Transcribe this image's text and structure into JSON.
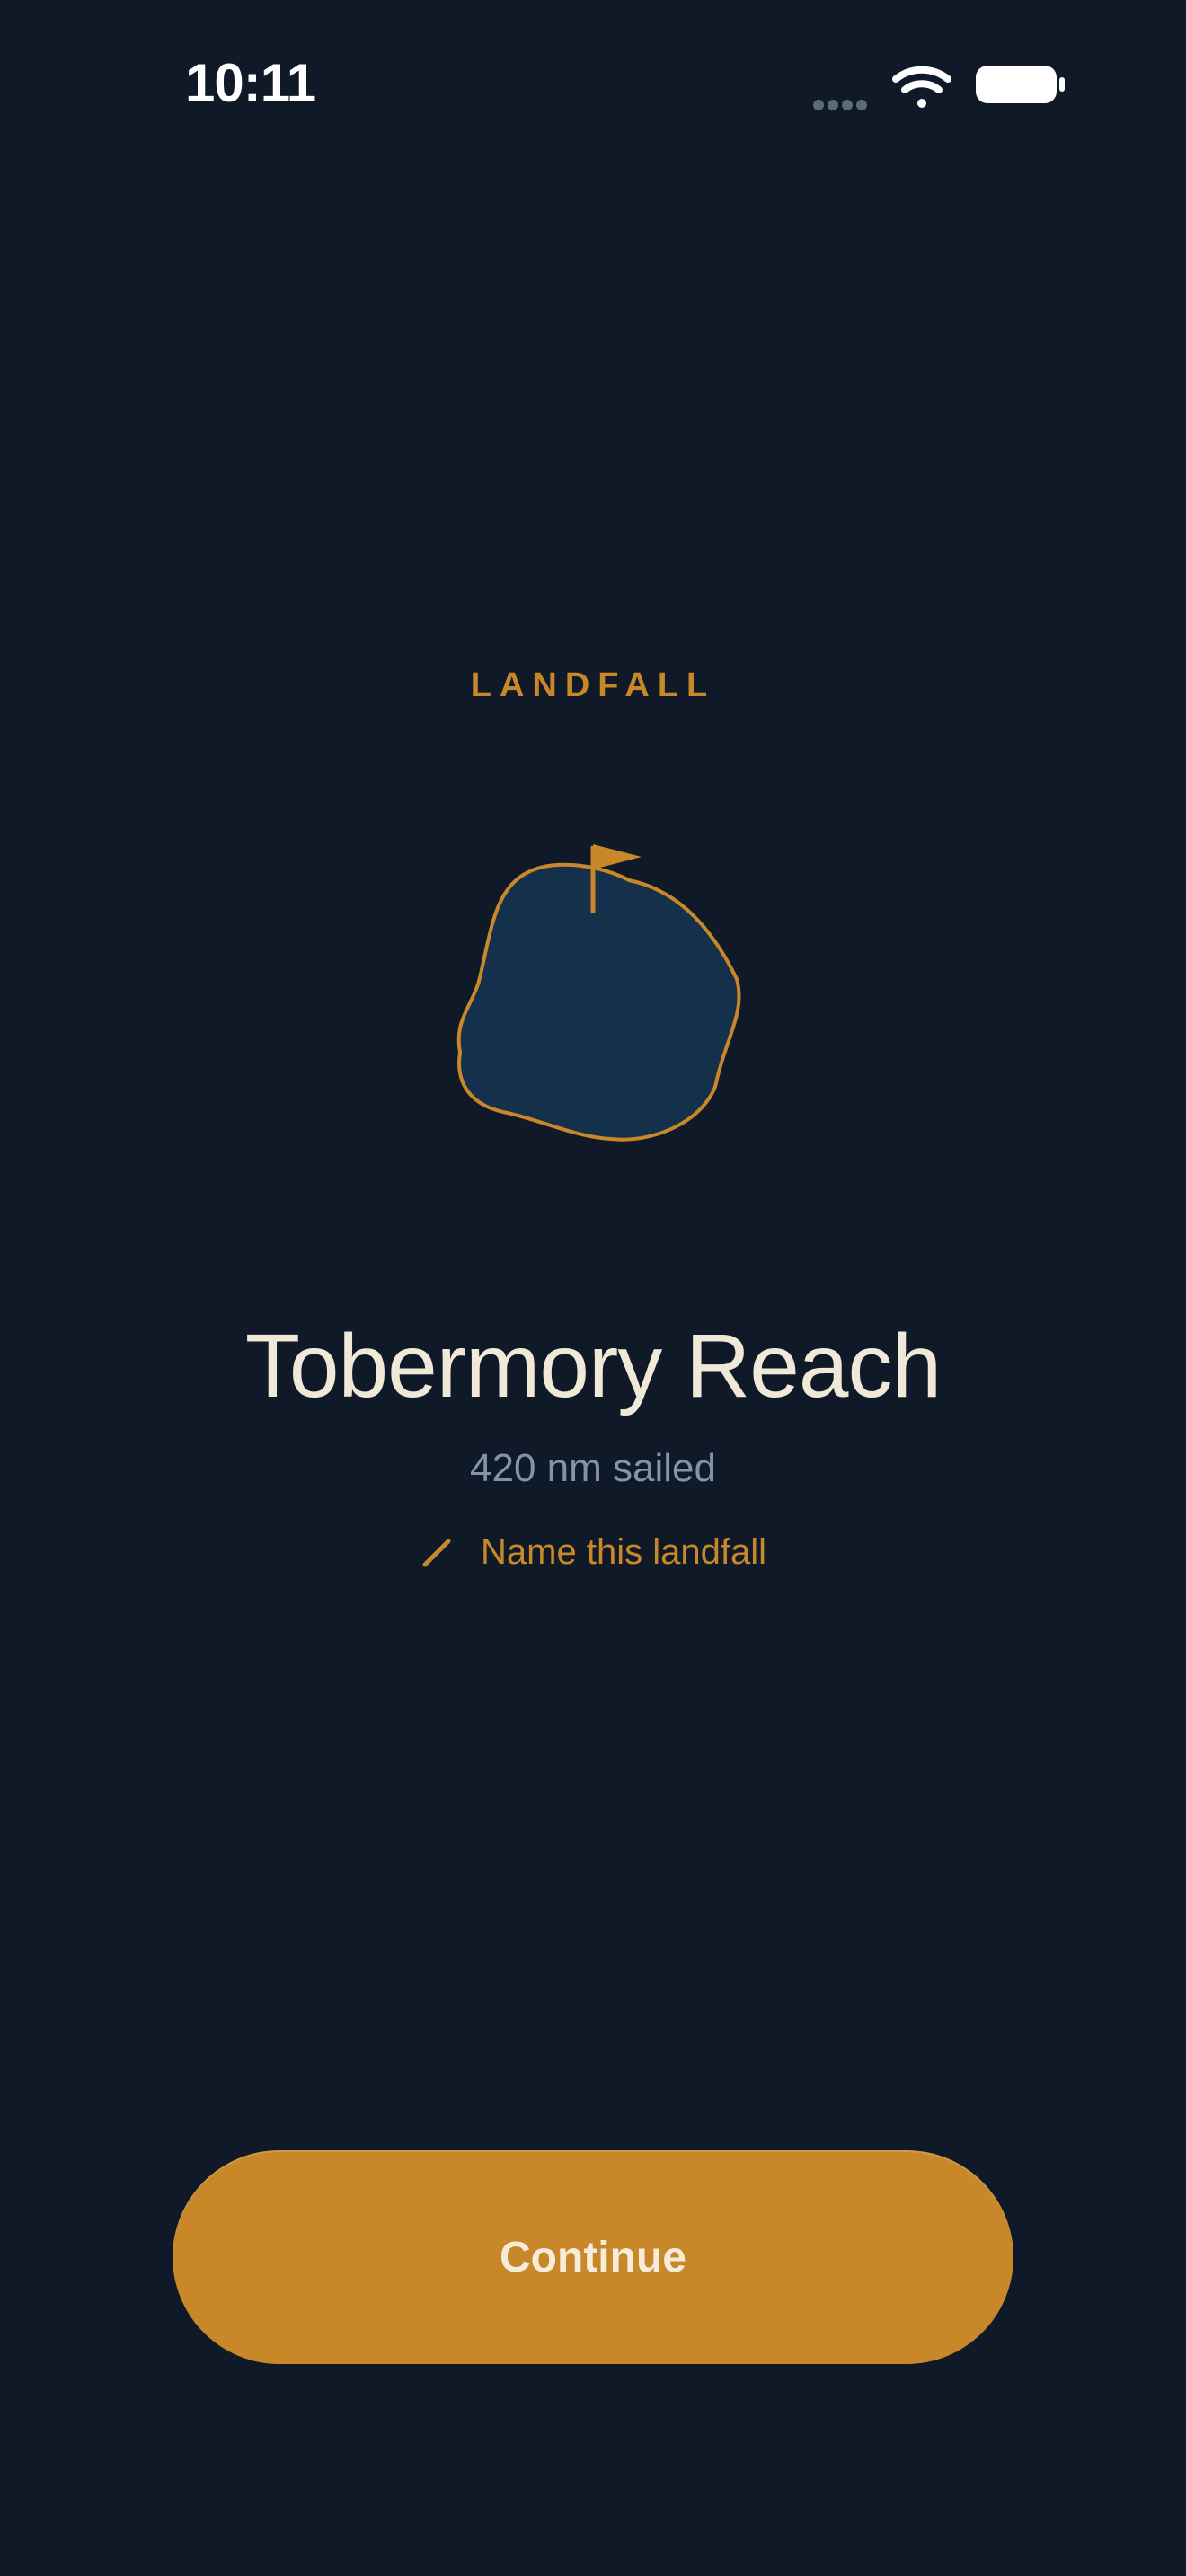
{
  "status_bar": {
    "time": "10:11",
    "icons": [
      "cellular-signal-icon",
      "wifi-icon",
      "battery-icon"
    ]
  },
  "landfall": {
    "eyebrow": "LANDFALL",
    "place_name": "Tobermory Reach",
    "distance": "420 nm sailed",
    "rename_label": "Name this landfall",
    "illustration": "island-flag-icon"
  },
  "actions": {
    "continue_label": "Continue"
  },
  "colors": {
    "background": "#0f1928",
    "accent": "#c8882a",
    "island_fill": "#15304b",
    "title_text": "#f1e9d8",
    "muted_text": "#8194a9"
  }
}
